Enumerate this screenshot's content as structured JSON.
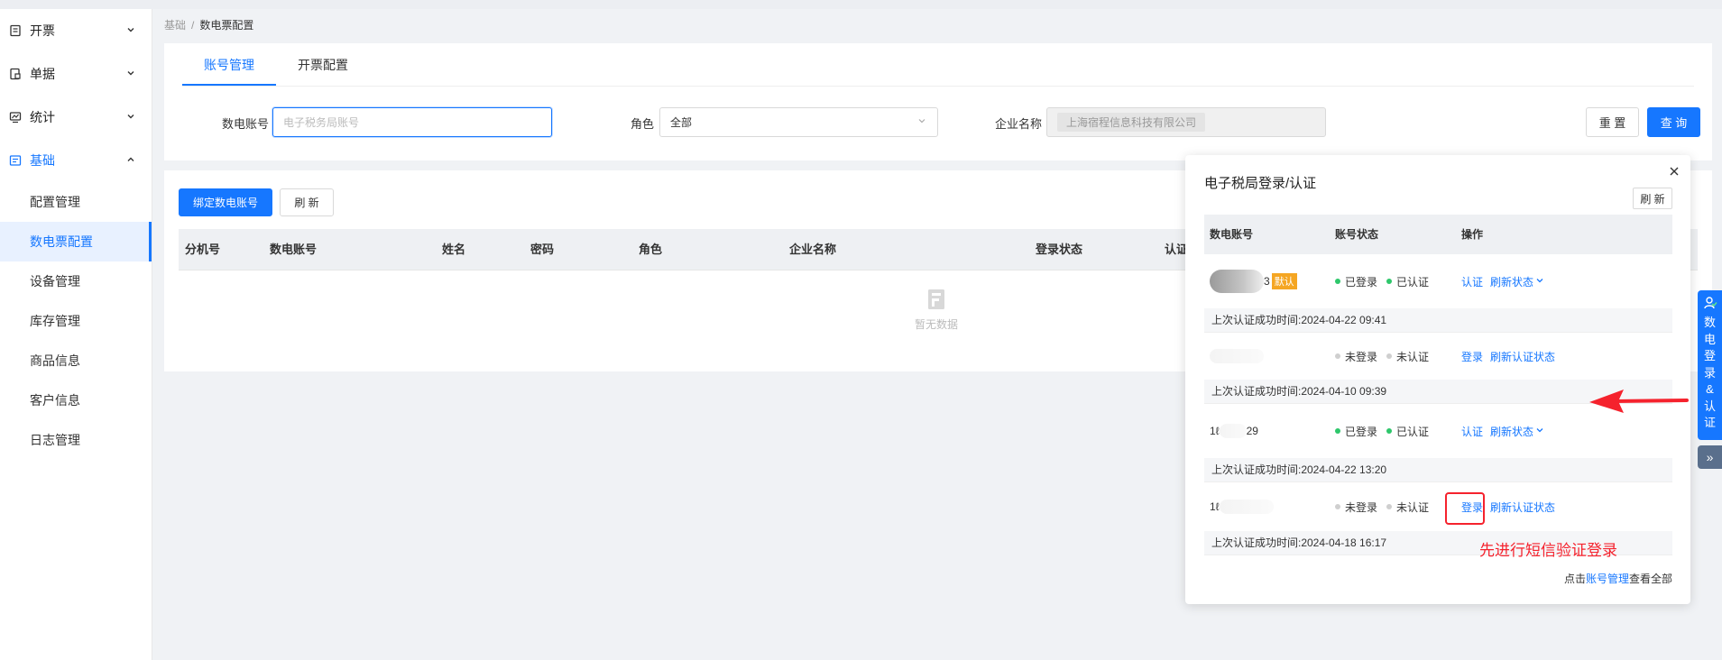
{
  "sidebar": {
    "groups": [
      {
        "label": "开票",
        "icon": "invoice-icon"
      },
      {
        "label": "单据",
        "icon": "document-icon"
      },
      {
        "label": "统计",
        "icon": "chart-icon"
      },
      {
        "label": "基础",
        "icon": "settings-box-icon"
      }
    ],
    "sub_items": [
      "配置管理",
      "数电票配置",
      "设备管理",
      "库存管理",
      "商品信息",
      "客户信息",
      "日志管理"
    ]
  },
  "breadcrumb": {
    "parent": "基础",
    "sep": "/",
    "current": "数电票配置"
  },
  "tabs": [
    "账号管理",
    "开票配置"
  ],
  "filters": {
    "account_label": "数电账号",
    "account_placeholder": "电子税务局账号",
    "role_label": "角色",
    "role_value": "全部",
    "company_label": "企业名称",
    "company_value": "上海宿程信息科技有限公司"
  },
  "buttons": {
    "reset": "重 置",
    "search": "查 询",
    "bind": "绑定数电账号",
    "refresh": "刷 新"
  },
  "table": {
    "columns": [
      "分机号",
      "数电账号",
      "姓名",
      "密码",
      "角色",
      "企业名称",
      "登录状态",
      "认证"
    ],
    "empty_text": "暂无数据"
  },
  "popup": {
    "title": "电子税局登录/认证",
    "refresh": "刷 新",
    "columns": [
      "数电账号",
      "账号状态",
      "操作"
    ],
    "rows": [
      {
        "account_suffix": "3",
        "badge": "默认",
        "login": "已登录",
        "auth": "已认证",
        "actions": [
          "认证",
          "刷新状态"
        ],
        "time": "上次认证成功时间:2024-04-22 09:41"
      },
      {
        "account_suffix": "",
        "badge": "",
        "login": "未登录",
        "auth": "未认证",
        "actions": [
          "登录",
          "刷新认证状态"
        ],
        "time": "上次认证成功时间:2024-04-10 09:39"
      },
      {
        "account_prefix": "1ℓ",
        "account_suffix": "29",
        "badge": "",
        "login": "已登录",
        "auth": "已认证",
        "actions": [
          "认证",
          "刷新状态"
        ],
        "time": "上次认证成功时间:2024-04-22 13:20"
      },
      {
        "account_prefix": "1ℓ",
        "account_suffix": "",
        "badge": "",
        "login": "未登录",
        "auth": "未认证",
        "actions": [
          "登录",
          "刷新认证状态"
        ],
        "time": "上次认证成功时间:2024-04-18 16:17"
      }
    ],
    "footer_prefix": "点击",
    "footer_link": "账号管理",
    "footer_suffix": "查看全部"
  },
  "annotation": "先进行短信验证登录",
  "float_tab": {
    "text": "数电登录&认证",
    "expand": "»"
  },
  "colors": {
    "primary": "#1677ff",
    "annotation_red": "#f5222d",
    "status_green": "#2ec76b"
  }
}
